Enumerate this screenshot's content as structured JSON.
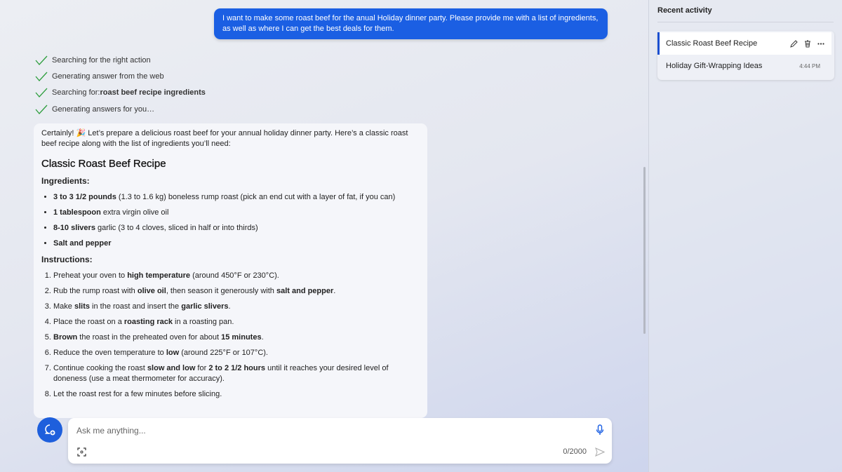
{
  "user_message": "I want to make some roast beef for the anual Holiday dinner party. Please provide me with a list of ingredients, as well as where I can get the best deals for them.",
  "steps": [
    {
      "text": "Searching for the right action",
      "bold": ""
    },
    {
      "text": "Generating answer from the web",
      "bold": ""
    },
    {
      "text": "Searching for: ",
      "bold": "roast beef recipe ingredients"
    },
    {
      "text": "Generating answers for you…",
      "bold": ""
    }
  ],
  "response": {
    "intro_pre": "Certainly! ",
    "intro_emoji": "🎉",
    "intro": " Let’s prepare a delicious roast beef for your annual holiday dinner party. Here’s a classic roast beef recipe along with the list of ingredients you’ll need:",
    "title": "Classic Roast Beef Recipe",
    "ingredients_heading": "Ingredients:",
    "ingredients": [
      [
        {
          "b": true,
          "t": "3 to 3 1/2 pounds"
        },
        {
          "t": " (1.3 to 1.6 kg) boneless rump roast (pick an end cut with a layer of fat, if you can)"
        }
      ],
      [
        {
          "b": true,
          "t": "1 tablespoon"
        },
        {
          "t": " extra virgin olive oil"
        }
      ],
      [
        {
          "b": true,
          "t": "8-10 slivers"
        },
        {
          "t": " garlic (3 to 4 cloves, sliced in half or into thirds)"
        }
      ],
      [
        {
          "b": true,
          "t": "Salt and pepper"
        }
      ]
    ],
    "instructions_heading": "Instructions:",
    "instructions": [
      [
        {
          "t": "Preheat your oven to "
        },
        {
          "b": true,
          "t": "high temperature"
        },
        {
          "t": " (around 450°F or 230°C)."
        }
      ],
      [
        {
          "t": "Rub the rump roast with "
        },
        {
          "b": true,
          "t": "olive oil"
        },
        {
          "t": ", then season it generously with "
        },
        {
          "b": true,
          "t": "salt and pepper"
        },
        {
          "t": "."
        }
      ],
      [
        {
          "t": "Make "
        },
        {
          "b": true,
          "t": "slits"
        },
        {
          "t": " in the roast and insert the "
        },
        {
          "b": true,
          "t": "garlic slivers"
        },
        {
          "t": "."
        }
      ],
      [
        {
          "t": "Place the roast on a "
        },
        {
          "b": true,
          "t": "roasting rack"
        },
        {
          "t": " in a roasting pan."
        }
      ],
      [
        {
          "b": true,
          "t": "Brown"
        },
        {
          "t": " the roast in the preheated oven for about "
        },
        {
          "b": true,
          "t": "15 minutes"
        },
        {
          "t": "."
        }
      ],
      [
        {
          "t": "Reduce the oven temperature to "
        },
        {
          "b": true,
          "t": "low"
        },
        {
          "t": " (around 225°F or 107°C)."
        }
      ],
      [
        {
          "t": "Continue cooking the roast "
        },
        {
          "b": true,
          "t": "slow and low"
        },
        {
          "t": " for "
        },
        {
          "b": true,
          "t": "2 to 2 1/2 hours"
        },
        {
          "t": " until it reaches your desired level of doneness (use a meat thermometer for accuracy)."
        }
      ],
      [
        {
          "t": "Let the roast rest for a few minutes before slicing."
        }
      ]
    ]
  },
  "composer": {
    "placeholder": "Ask me anything...",
    "counter": "0/2000"
  },
  "sidebar": {
    "title": "Recent activity",
    "items": [
      {
        "label": "Classic Roast Beef Recipe",
        "active": true
      },
      {
        "label": "Holiday Gift-Wrapping Ideas",
        "time": "4:44 PM"
      }
    ]
  },
  "colors": {
    "accent": "#1b5fe3",
    "check": "#2e9e3e"
  }
}
